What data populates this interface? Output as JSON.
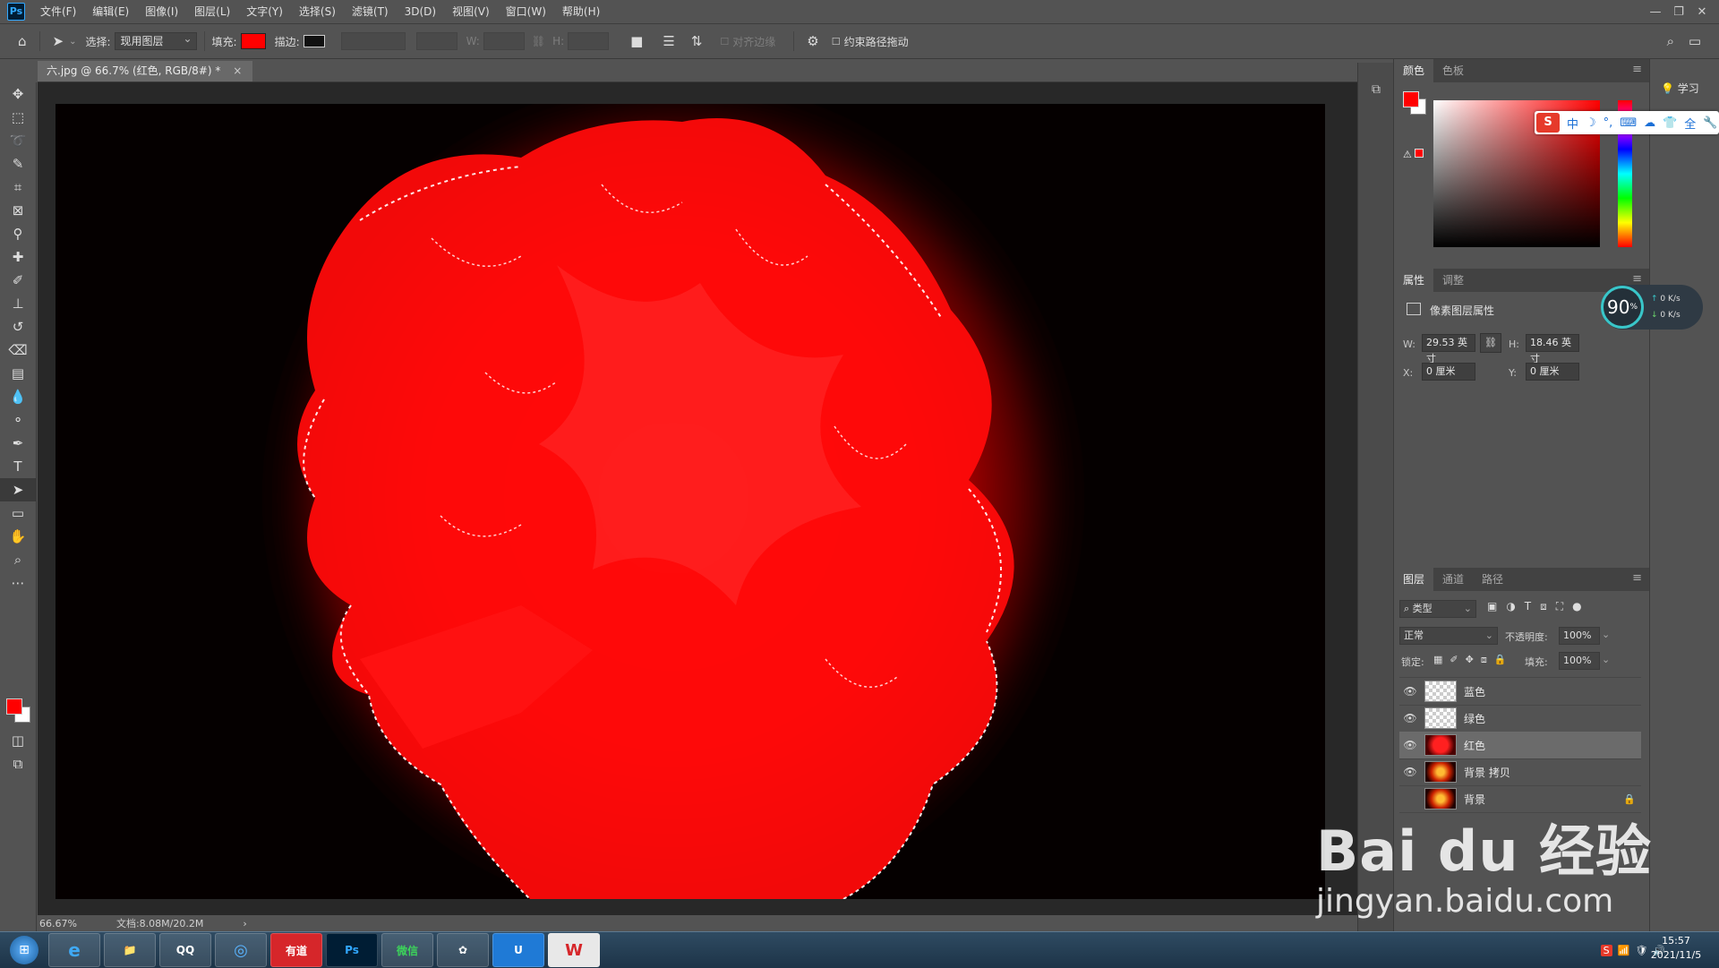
{
  "app": {
    "logo": "Ps",
    "menu": [
      "文件(F)",
      "编辑(E)",
      "图像(I)",
      "图层(L)",
      "文字(Y)",
      "选择(S)",
      "滤镜(T)",
      "3D(D)",
      "视图(V)",
      "窗口(W)",
      "帮助(H)"
    ]
  },
  "options_bar": {
    "select_label": "选择:",
    "select_value": "现用图层",
    "fill_label": "填充:",
    "stroke_label": "描边:",
    "w_label": "W:",
    "h_label": "H:",
    "align_edges": "对齐边缘",
    "constrain_path": "约束路径拖动",
    "fill_color": "#ff0000"
  },
  "document": {
    "tab_title": "六.jpg @ 66.7% (红色, RGB/8#) *",
    "tab_close": "×",
    "zoom": "66.67%",
    "doc_info": "文档:8.08M/20.2M",
    "status_arrow": "›"
  },
  "color_panel": {
    "tabs": [
      "颜色",
      "色板"
    ],
    "foreground": "#ff0000",
    "background": "#ffffff"
  },
  "properties_panel": {
    "tabs": [
      "属性",
      "调整"
    ],
    "title": "像素图层属性",
    "w_label": "W:",
    "w_value": "29.53 英寸",
    "h_label": "H:",
    "h_value": "18.46 英寸",
    "x_label": "X:",
    "x_value": "0 厘米",
    "y_label": "Y:",
    "y_value": "0 厘米"
  },
  "layers_panel": {
    "tabs": [
      "图层",
      "通道",
      "路径"
    ],
    "filter_kind": "类型",
    "blend_mode": "正常",
    "opacity_label": "不透明度:",
    "opacity_value": "100%",
    "lock_label": "锁定:",
    "fill_label": "填充:",
    "fill_value": "100%",
    "layers": [
      {
        "name": "蓝色",
        "visible": true,
        "thumb": "transparent",
        "selected": false,
        "locked": false
      },
      {
        "name": "绿色",
        "visible": true,
        "thumb": "transparent",
        "selected": false,
        "locked": false
      },
      {
        "name": "红色",
        "visible": true,
        "thumb": "red",
        "selected": true,
        "locked": false
      },
      {
        "name": "背景 拷贝",
        "visible": true,
        "thumb": "fire",
        "selected": false,
        "locked": false
      },
      {
        "name": "背景",
        "visible": false,
        "thumb": "fire",
        "selected": false,
        "locked": true
      }
    ]
  },
  "learn_panel": {
    "label": "学习"
  },
  "ime": {
    "items": [
      "中",
      "☽",
      "°,",
      "⌨",
      "☁",
      "👕",
      "全",
      "🔧"
    ]
  },
  "speed_widget": {
    "percent": "90",
    "unit": "%",
    "up": "0 K/s",
    "down": "0 K/s"
  },
  "watermark": {
    "main": "Bai du 经验",
    "sub": "jingyan.baidu.com"
  },
  "taskbar": {
    "apps": [
      "e",
      "📁",
      "QQ",
      "◎",
      "有道",
      "Ps",
      "微信",
      "✿",
      "U",
      "W"
    ],
    "time": "15:57",
    "date": "2021/11/5"
  }
}
